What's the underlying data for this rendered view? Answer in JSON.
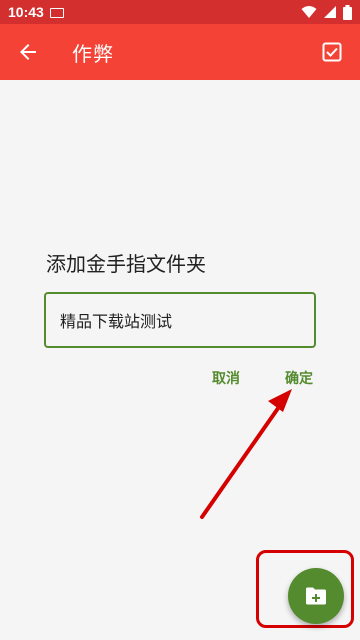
{
  "status_bar": {
    "time": "10:43",
    "icons": [
      "notification-icon",
      "wifi-icon",
      "signal-icon",
      "battery-icon"
    ]
  },
  "app_bar": {
    "title": "作弊",
    "back_icon": "arrow-back-icon",
    "action_icon": "checkbox-icon",
    "color": "#f44336"
  },
  "dialog": {
    "title": "添加金手指文件夹",
    "input_value": "精品下载站测试",
    "cancel_label": "取消",
    "ok_label": "确定",
    "accent_color": "#558b2f"
  },
  "fab": {
    "icon": "create-new-folder-icon",
    "color": "#558b2f"
  },
  "annotations": {
    "arrow_color": "#d50000",
    "highlight_color": "#d50000"
  }
}
